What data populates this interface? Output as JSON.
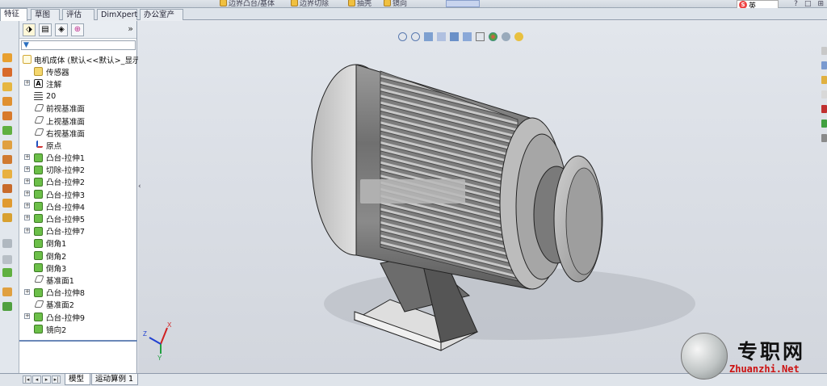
{
  "toolbar_top": {
    "items": [
      "边界凸台/基体",
      "边界切除",
      "抽壳",
      "镜向"
    ]
  },
  "command_tabs": [
    "特征",
    "草图",
    "评估",
    "DimXpert",
    "办公室产品"
  ],
  "active_command_tab": "特征",
  "ime": {
    "badge": "S",
    "label": "英"
  },
  "window_buttons": [
    "?",
    "□",
    "⊞"
  ],
  "feature_manager": {
    "tab_icons": [
      "feature-tree-icon",
      "property-icon",
      "config-icon",
      "appearance-icon"
    ],
    "expand_label": "»",
    "filter_icon": "▼",
    "root": "电机成体 (默认<<默认>_显示",
    "items": [
      {
        "label": "传感器",
        "icon": "sensor-icon",
        "expandable": false
      },
      {
        "label": "注解",
        "icon": "annotation-icon",
        "expandable": true
      },
      {
        "label": "20",
        "icon": "material-icon",
        "expandable": false
      },
      {
        "label": "前视基准面",
        "icon": "plane-icon",
        "expandable": false
      },
      {
        "label": "上视基准面",
        "icon": "plane-icon",
        "expandable": false
      },
      {
        "label": "右视基准面",
        "icon": "plane-icon",
        "expandable": false
      },
      {
        "label": "原点",
        "icon": "origin-icon",
        "expandable": false
      },
      {
        "label": "凸台-拉伸1",
        "icon": "extrude-icon",
        "expandable": true
      },
      {
        "label": "切除-拉伸2",
        "icon": "cut-icon",
        "expandable": true
      },
      {
        "label": "凸台-拉伸2",
        "icon": "extrude-icon",
        "expandable": true
      },
      {
        "label": "凸台-拉伸3",
        "icon": "extrude-icon",
        "expandable": true
      },
      {
        "label": "凸台-拉伸4",
        "icon": "extrude-icon",
        "expandable": true
      },
      {
        "label": "凸台-拉伸5",
        "icon": "extrude-icon",
        "expandable": true
      },
      {
        "label": "凸台-拉伸7",
        "icon": "extrude-icon",
        "expandable": true
      },
      {
        "label": "倒角1",
        "icon": "chamfer-icon",
        "expandable": false
      },
      {
        "label": "倒角2",
        "icon": "chamfer-icon",
        "expandable": false
      },
      {
        "label": "倒角3",
        "icon": "chamfer-icon",
        "expandable": false
      },
      {
        "label": "基准面1",
        "icon": "plane-icon",
        "expandable": false
      },
      {
        "label": "凸台-拉伸8",
        "icon": "extrude-icon",
        "expandable": true
      },
      {
        "label": "基准面2",
        "icon": "plane-icon",
        "expandable": false
      },
      {
        "label": "凸台-拉伸9",
        "icon": "extrude-icon",
        "expandable": true
      },
      {
        "label": "镜向2",
        "icon": "mirror-icon",
        "expandable": false
      }
    ]
  },
  "bottom_tabs": [
    "模型",
    "运动算例 1"
  ],
  "active_bottom_tab": "模型",
  "bottom_nav": [
    "|◂",
    "◂",
    "▸",
    "▸|"
  ],
  "triad_labels": {
    "x": "X",
    "y": "Y",
    "z": "Z"
  },
  "watermark": {
    "cn": "专职网",
    "en": "Zhuanzhi.Net"
  },
  "colors": {
    "accent": "#6b88b8",
    "watermark_red": "#cc1010"
  }
}
